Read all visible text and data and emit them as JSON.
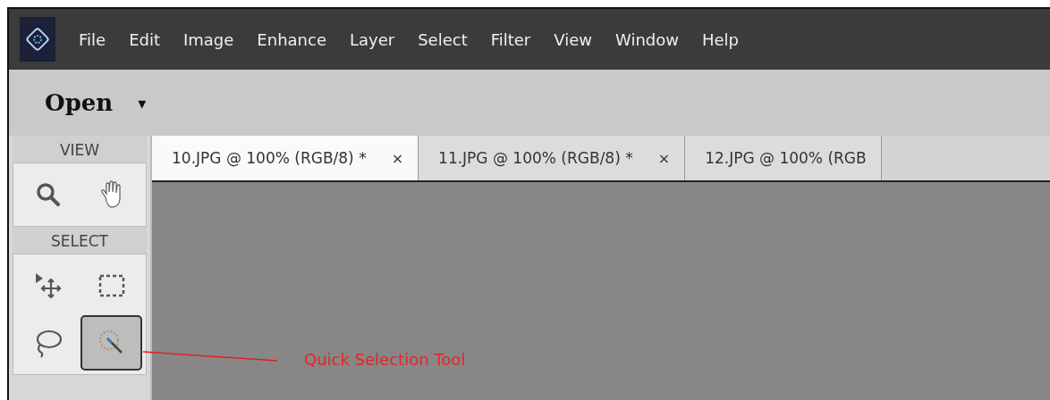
{
  "menu_bar": {
    "items": [
      "File",
      "Edit",
      "Image",
      "Enhance",
      "Layer",
      "Select",
      "Filter",
      "View",
      "Window",
      "Help"
    ]
  },
  "toolbar": {
    "mode": "Open",
    "dropdown": "▾"
  },
  "tool_panel": {
    "sections": [
      {
        "title": "VIEW",
        "tools": [
          {
            "kind": "zoom",
            "selected": false
          },
          {
            "kind": "hand",
            "selected": false
          }
        ]
      },
      {
        "title": "SELECT",
        "tools": [
          {
            "kind": "move",
            "selected": false
          },
          {
            "kind": "marquee",
            "selected": false
          },
          {
            "kind": "lasso",
            "selected": false
          },
          {
            "kind": "quick_selection",
            "selected": true
          }
        ]
      }
    ]
  },
  "document_tabs": [
    {
      "label": "10.JPG @ 100% (RGB/8) *",
      "close": "×",
      "selected": true
    },
    {
      "label": "11.JPG @ 100% (RGB/8) *",
      "close": "×",
      "selected": false
    },
    {
      "label": "12.JPG @ 100% (RGB",
      "selected": false
    }
  ],
  "annotation": {
    "text": "Quick Selection Tool"
  }
}
